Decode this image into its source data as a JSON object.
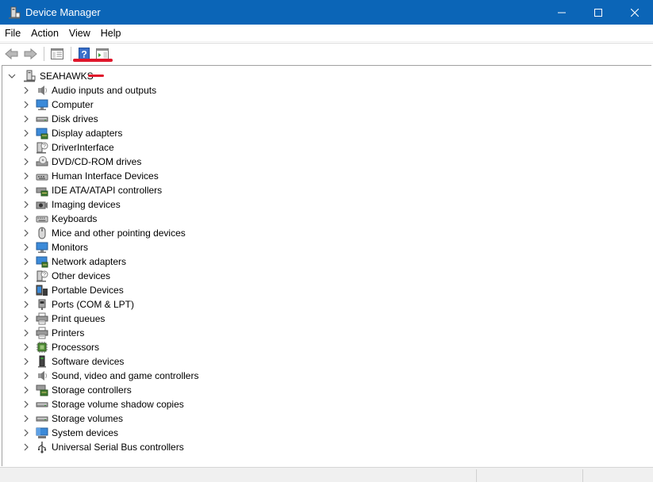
{
  "window": {
    "title": "Device Manager",
    "controls": {
      "minimize_icon": "minimize-icon",
      "maximize_icon": "maximize-icon",
      "close_icon": "close-icon"
    }
  },
  "menubar": {
    "items": [
      "File",
      "Action",
      "View",
      "Help"
    ]
  },
  "toolbar": {
    "buttons": [
      "back-icon",
      "forward-icon",
      "show-hide-console-tree-icon",
      "help-icon",
      "show-action-pane-icon"
    ]
  },
  "tree": {
    "root": {
      "label": "SEAHAWKS",
      "icon": "computer-tower-icon",
      "expanded": true
    },
    "categories": [
      {
        "label": "Audio inputs and outputs",
        "icon": "speaker-icon"
      },
      {
        "label": "Computer",
        "icon": "computer-monitor-icon"
      },
      {
        "label": "Disk drives",
        "icon": "disk-drive-icon"
      },
      {
        "label": "Display adapters",
        "icon": "display-adapter-icon"
      },
      {
        "label": "DriverInterface",
        "icon": "unknown-device-icon"
      },
      {
        "label": "DVD/CD-ROM drives",
        "icon": "dvd-drive-icon"
      },
      {
        "label": "Human Interface Devices",
        "icon": "hid-icon"
      },
      {
        "label": "IDE ATA/ATAPI controllers",
        "icon": "ide-controller-icon"
      },
      {
        "label": "Imaging devices",
        "icon": "camera-icon"
      },
      {
        "label": "Keyboards",
        "icon": "keyboard-icon"
      },
      {
        "label": "Mice and other pointing devices",
        "icon": "mouse-icon"
      },
      {
        "label": "Monitors",
        "icon": "monitor-icon"
      },
      {
        "label": "Network adapters",
        "icon": "network-adapter-icon"
      },
      {
        "label": "Other devices",
        "icon": "unknown-device-icon"
      },
      {
        "label": "Portable Devices",
        "icon": "portable-device-icon"
      },
      {
        "label": "Ports (COM & LPT)",
        "icon": "port-icon"
      },
      {
        "label": "Print queues",
        "icon": "printer-icon"
      },
      {
        "label": "Printers",
        "icon": "printer-icon"
      },
      {
        "label": "Processors",
        "icon": "processor-icon"
      },
      {
        "label": "Software devices",
        "icon": "software-device-icon"
      },
      {
        "label": "Sound, video and game controllers",
        "icon": "speaker-icon"
      },
      {
        "label": "Storage controllers",
        "icon": "storage-controller-icon"
      },
      {
        "label": "Storage volume shadow copies",
        "icon": "disk-drive-icon"
      },
      {
        "label": "Storage volumes",
        "icon": "disk-drive-icon"
      },
      {
        "label": "System devices",
        "icon": "system-device-icon"
      },
      {
        "label": "Universal Serial Bus controllers",
        "icon": "usb-icon"
      }
    ]
  },
  "colors": {
    "titlebar": "#0b65b7",
    "annotation": "#e0162b"
  }
}
